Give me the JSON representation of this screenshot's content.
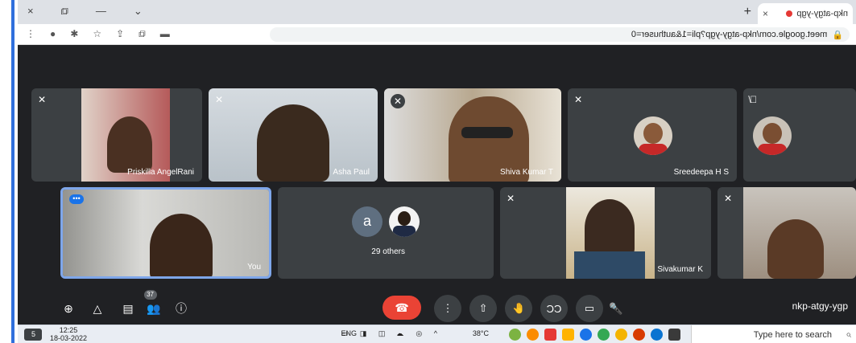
{
  "browser": {
    "tab_title": "nkp-atgy-ygp",
    "tab_close": "×",
    "new_tab": "+",
    "url": "meet.google.com/nkp-atgy-ygp?pli=1&authuser=0",
    "window_controls": {
      "minimize": "—",
      "maximize": "⧉",
      "close": "×",
      "tab_list": "⌄"
    }
  },
  "participants": [
    {
      "name": "",
      "muted": true
    },
    {
      "name": "Sreedeepa H S",
      "muted": true
    },
    {
      "name": "Shiva Kumar T",
      "muted": true
    },
    {
      "name": "Asha Paul",
      "muted": true
    },
    {
      "name": "Priskilla AngelRani",
      "muted": true
    },
    {
      "name": "",
      "muted": true
    },
    {
      "name": "Sivakumar K",
      "muted": true
    },
    {
      "name": "29 others",
      "initial": "a"
    },
    {
      "name": "You",
      "menu": "•••"
    }
  ],
  "controls": {
    "meeting_code": "nkp-atgy-ygp",
    "people_count": "37",
    "end_call_icon": "phone-hangup-icon"
  },
  "taskbar": {
    "search_placeholder": "Type here to search",
    "weather": "38°C",
    "language": "ENG",
    "time": "12:25",
    "date": "18-03-2022",
    "notification": "5"
  },
  "colors": {
    "meet_bg": "#202124",
    "tile_bg": "#3c4043",
    "end_call": "#ea4335",
    "accent": "#1a73e8"
  }
}
